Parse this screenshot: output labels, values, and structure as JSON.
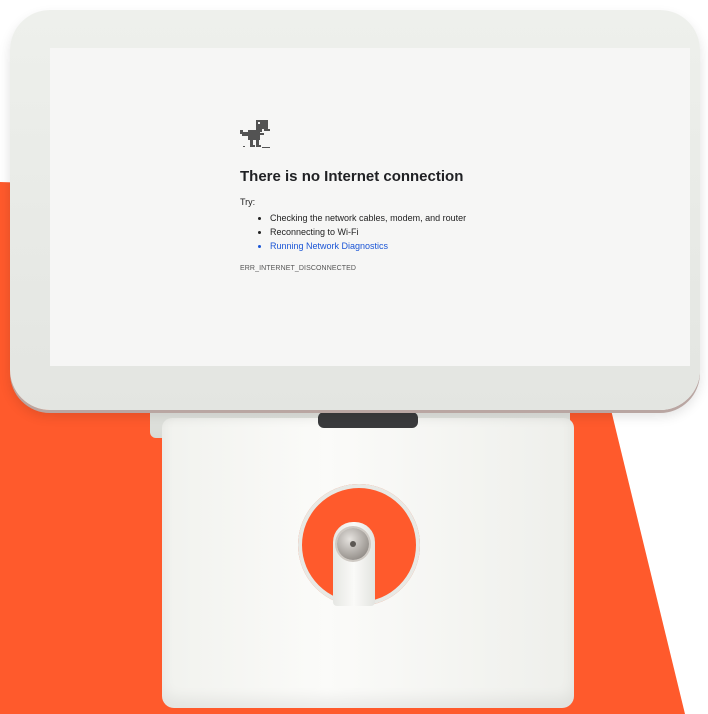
{
  "colors": {
    "background_accent": "#ff5a2c",
    "screen": "#f6f6f5",
    "link": "#1a55d6"
  },
  "error_page": {
    "icon": "dinosaur-icon",
    "title": "There is no Internet connection",
    "try_label": "Try:",
    "suggestions": [
      "Checking the network cables, modem, and router",
      "Reconnecting to Wi-Fi",
      "Running Network Diagnostics"
    ],
    "error_code": "ERR_INTERNET_DISCONNECTED"
  },
  "device": {
    "power_button_icon": "power-button-icon"
  }
}
